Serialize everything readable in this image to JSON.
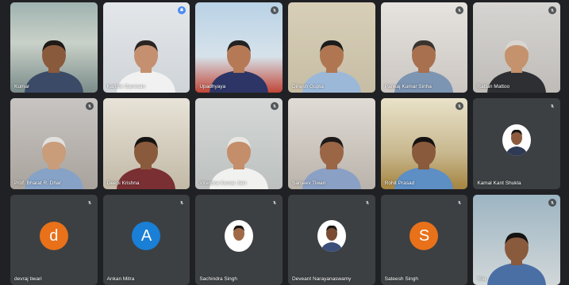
{
  "participants": [
    {
      "name": "Kumar",
      "style": "office1",
      "skin": "#8a5a3c",
      "shirt": "#3b4a66",
      "hair": "#1e1a18",
      "mic": "muted"
    },
    {
      "name": "Karthik Ganesan",
      "style": "white",
      "skin": "#c49070",
      "shirt": "#f1f1f1",
      "hair": "#2a2522",
      "mic": "active"
    },
    {
      "name": "Upadhyaya",
      "style": "sky",
      "skin": "#b57a55",
      "shirt": "#2c3566",
      "hair": "#222",
      "mic": "muted"
    },
    {
      "name": "Dinesh Gupta",
      "style": "beige",
      "skin": "#b07652",
      "shirt": "#9cb8d8",
      "hair": "#1c1c1c",
      "mic": "muted"
    },
    {
      "name": "Pankaj Kumar Sinha",
      "style": "wall",
      "skin": "#a8704e",
      "shirt": "#7c95b3",
      "hair": "#3a3430",
      "mic": "muted"
    },
    {
      "name": "Rattan Mattoo",
      "style": "grey",
      "skin": "#c4926c",
      "shirt": "#2e2f33",
      "hair": "#d9d6d2",
      "mic": "muted"
    },
    {
      "name": "Prof. Bharat R. Dhar",
      "style": "room1",
      "skin": "#c99c7a",
      "shirt": "#86a2c7",
      "hair": "#e2e0de",
      "mic": "muted"
    },
    {
      "name": "Deepi Krishna",
      "style": "room2",
      "skin": "#8a5a3c",
      "shirt": "#7a2f33",
      "hair": "#161412",
      "mic": "muted"
    },
    {
      "name": "Virendra Kumar Jain",
      "style": "room3",
      "skin": "#c48e6a",
      "shirt": "#f1f1ef",
      "hair": "#e8e6e2",
      "mic": "muted"
    },
    {
      "name": "Sanjeev Tiwari",
      "style": "room4",
      "skin": "#9a6646",
      "shirt": "#8aa0c4",
      "hair": "#1d1b19",
      "mic": "muted"
    },
    {
      "name": "Rohit Prasad",
      "style": "room5",
      "skin": "#8a5a3c",
      "shirt": "#5d8ec4",
      "hair": "#151311",
      "mic": "muted"
    }
  ],
  "avatars": [
    {
      "name": "Kamal Kant Shukla",
      "type": "photo",
      "color": "#ffffff",
      "skin": "#8c5b3e",
      "shirt": "#2f3a55"
    },
    {
      "name": "devraj tiwari",
      "type": "letter",
      "letter": "d",
      "color": "#e8711a"
    },
    {
      "name": "Ankan Mitra",
      "type": "letter",
      "letter": "A",
      "color": "#1a7fd6"
    },
    {
      "name": "Sachindra Singh",
      "type": "photo",
      "color": "#ffffff",
      "skin": "#a06a48",
      "shirt": "#ffffff"
    },
    {
      "name": "Deveant Narayanaswamy",
      "type": "photo",
      "color": "#ffffff",
      "skin": "#7a4c33",
      "shirt": "#3b4f7a"
    },
    {
      "name": "Sateesh Singh",
      "type": "letter",
      "letter": "S",
      "color": "#e8711a"
    }
  ],
  "self_view": {
    "name": "You",
    "skin": "#8a5a3c",
    "shirt": "#4a6fa5",
    "hair": "#151311"
  }
}
